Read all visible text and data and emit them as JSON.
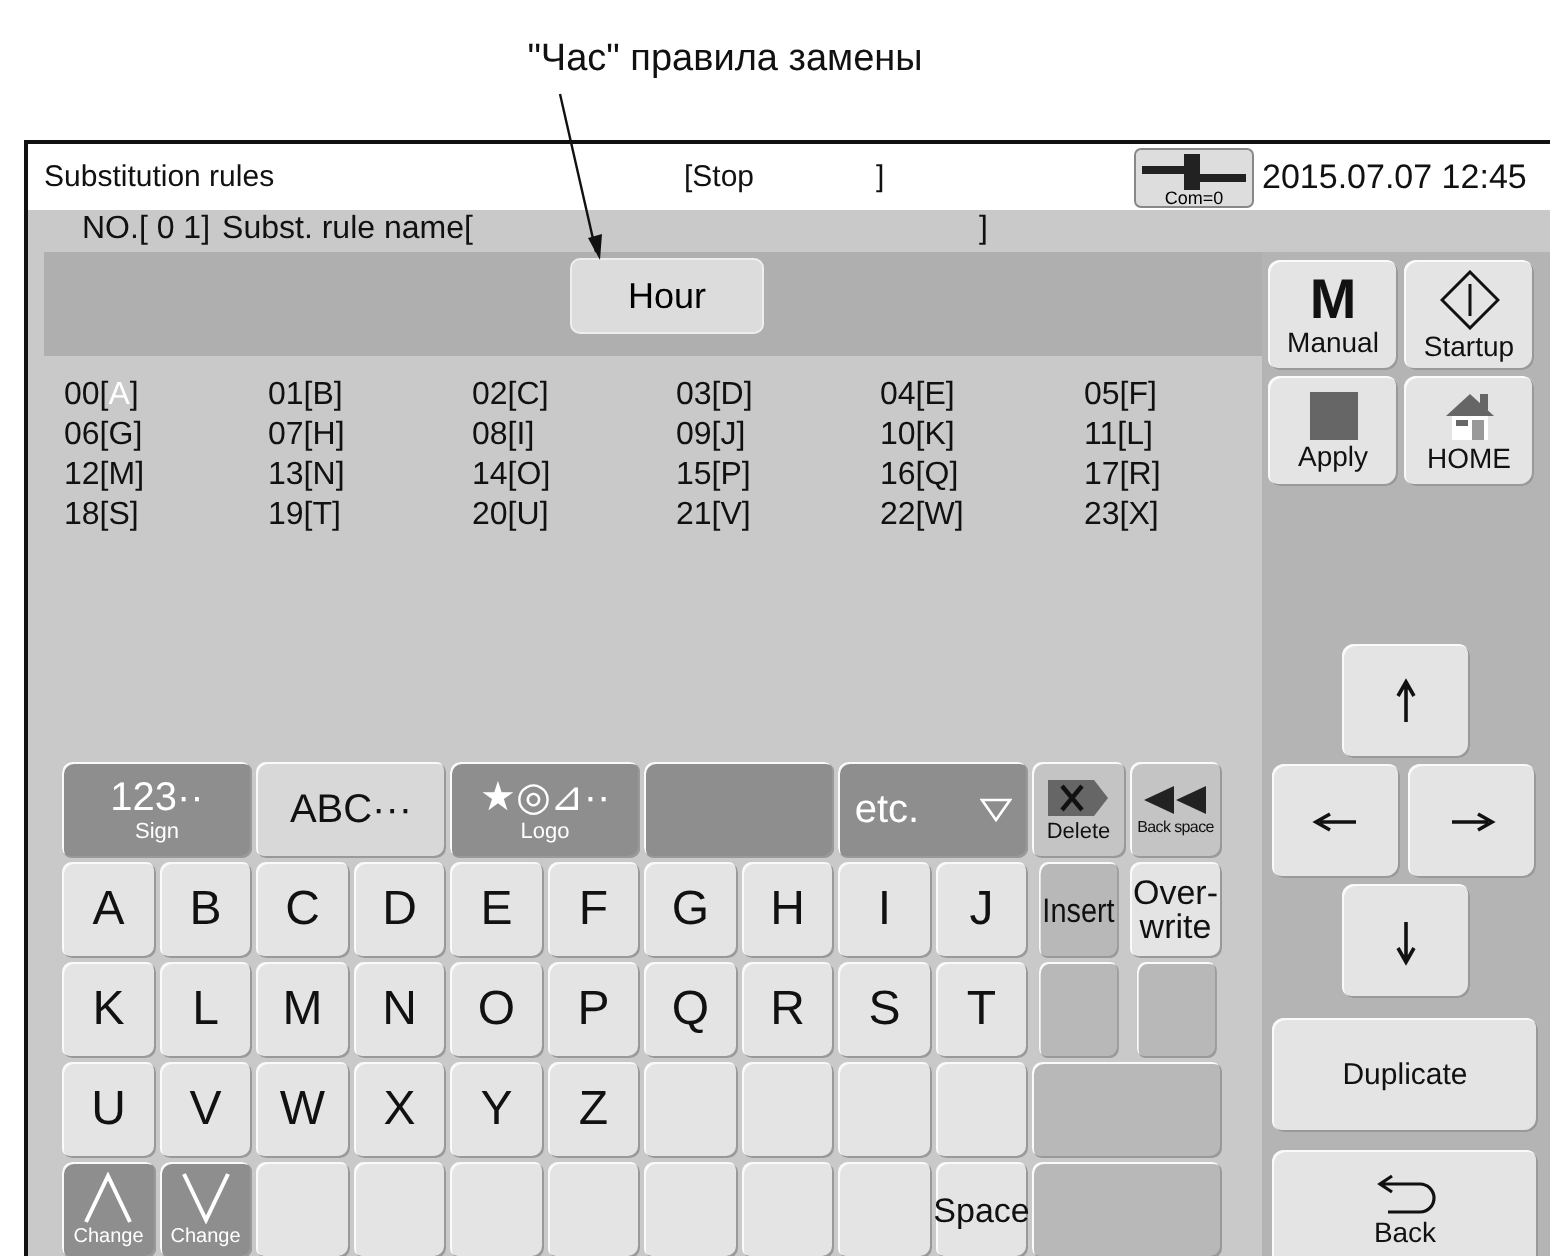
{
  "annotation": {
    "caption": "\"Час\" правила замены"
  },
  "window": {
    "title": "Substitution rules",
    "status": "[Stop",
    "status_end": "]",
    "com_label": "Com=0",
    "datetime": "2015.07.07 12:45"
  },
  "rule": {
    "number": "NO.[ 0 1]",
    "name_label": "Subst.  rule name[",
    "name_end": "]"
  },
  "hour_button": {
    "label": "Hour"
  },
  "characters": [
    {
      "before": "00[",
      "char": "A",
      "after": "]",
      "selected": true
    },
    {
      "before": "01[",
      "char": "B",
      "after": "]",
      "selected": false
    },
    {
      "before": "02[",
      "char": "C",
      "after": "]",
      "selected": false
    },
    {
      "before": "03[",
      "char": "D",
      "after": "]",
      "selected": false
    },
    {
      "before": "04[",
      "char": "E",
      "after": "]",
      "selected": false
    },
    {
      "before": "05[",
      "char": "F",
      "after": "]",
      "selected": false
    },
    {
      "before": "06[",
      "char": "G",
      "after": "]",
      "selected": false
    },
    {
      "before": "07[",
      "char": "H",
      "after": "]",
      "selected": false
    },
    {
      "before": "08[",
      "char": "I",
      "after": "]",
      "selected": false
    },
    {
      "before": "09[",
      "char": "J",
      "after": "]",
      "selected": false
    },
    {
      "before": "10[",
      "char": "K",
      "after": "]",
      "selected": false
    },
    {
      "before": "11[",
      "char": "L",
      "after": "]",
      "selected": false
    },
    {
      "before": "12[",
      "char": "M",
      "after": "]",
      "selected": false
    },
    {
      "before": "13[",
      "char": "N",
      "after": "]",
      "selected": false
    },
    {
      "before": "14[",
      "char": "O",
      "after": "]",
      "selected": false
    },
    {
      "before": "15[",
      "char": "P",
      "after": "]",
      "selected": false
    },
    {
      "before": "16[",
      "char": "Q",
      "after": "]",
      "selected": false
    },
    {
      "before": "17[",
      "char": "R",
      "after": "]",
      "selected": false
    },
    {
      "before": "18[",
      "char": "S",
      "after": "]",
      "selected": false
    },
    {
      "before": "19[",
      "char": "T",
      "after": "]",
      "selected": false
    },
    {
      "before": "20[",
      "char": "U",
      "after": "]",
      "selected": false
    },
    {
      "before": "21[",
      "char": "V",
      "after": "]",
      "selected": false
    },
    {
      "before": "22[",
      "char": "W",
      "after": "]",
      "selected": false
    },
    {
      "before": "23[",
      "char": "X",
      "after": "]",
      "selected": false
    }
  ],
  "keyboard": {
    "keys": [
      {
        "kind": "tab",
        "label": "123··",
        "sublabel": "Sign",
        "selected": false
      },
      {
        "kind": "tab",
        "label": "ABC···",
        "selected": true
      },
      {
        "kind": "tab",
        "label": "★◎⊿··",
        "sublabel": "Logo",
        "selected": false
      },
      {
        "kind": "tab",
        "selected": false
      },
      {
        "kind": "tab",
        "label": "etc.",
        "dropdown": true,
        "selected": false
      },
      {
        "kind": "delete",
        "sublabel": "Delete"
      },
      {
        "kind": "backspace",
        "sublabel": "Back space"
      },
      {
        "kind": "letter",
        "label": "A"
      },
      {
        "kind": "letter",
        "label": "B"
      },
      {
        "kind": "letter",
        "label": "C"
      },
      {
        "kind": "letter",
        "label": "D"
      },
      {
        "kind": "letter",
        "label": "E"
      },
      {
        "kind": "letter",
        "label": "F"
      },
      {
        "kind": "letter",
        "label": "G"
      },
      {
        "kind": "letter",
        "label": "H"
      },
      {
        "kind": "letter",
        "label": "I"
      },
      {
        "kind": "letter",
        "label": "J"
      },
      {
        "kind": "dim",
        "label": "Insert"
      },
      {
        "kind": "func",
        "label": "Over-\nwrite"
      },
      {
        "kind": "letter",
        "label": "K"
      },
      {
        "kind": "letter",
        "label": "L"
      },
      {
        "kind": "letter",
        "label": "M"
      },
      {
        "kind": "letter",
        "label": "N"
      },
      {
        "kind": "letter",
        "label": "O"
      },
      {
        "kind": "letter",
        "label": "P"
      },
      {
        "kind": "letter",
        "label": "Q"
      },
      {
        "kind": "letter",
        "label": "R"
      },
      {
        "kind": "letter",
        "label": "S"
      },
      {
        "kind": "letter",
        "label": "T"
      },
      {
        "kind": "dim"
      },
      {
        "kind": "dim"
      },
      {
        "kind": "letter",
        "label": "U"
      },
      {
        "kind": "letter",
        "label": "V"
      },
      {
        "kind": "letter",
        "label": "W"
      },
      {
        "kind": "letter",
        "label": "X"
      },
      {
        "kind": "letter",
        "label": "Y"
      },
      {
        "kind": "letter",
        "label": "Z"
      },
      {
        "kind": "letter"
      },
      {
        "kind": "letter"
      },
      {
        "kind": "letter"
      },
      {
        "kind": "letter"
      },
      {
        "kind": "wide"
      },
      {
        "kind": "change-up",
        "sublabel": "Change"
      },
      {
        "kind": "change-down",
        "sublabel": "Change"
      },
      {
        "kind": "letter"
      },
      {
        "kind": "letter"
      },
      {
        "kind": "letter"
      },
      {
        "kind": "letter"
      },
      {
        "kind": "letter"
      },
      {
        "kind": "letter"
      },
      {
        "kind": "letter"
      },
      {
        "kind": "func",
        "label": "Space"
      },
      {
        "kind": "wide"
      }
    ]
  },
  "side_panel": {
    "manual": {
      "letter": "M",
      "label": "Manual"
    },
    "startup": "Startup",
    "apply": "Apply",
    "home": "HOME",
    "duplicate": "Duplicate",
    "back": "Back"
  }
}
